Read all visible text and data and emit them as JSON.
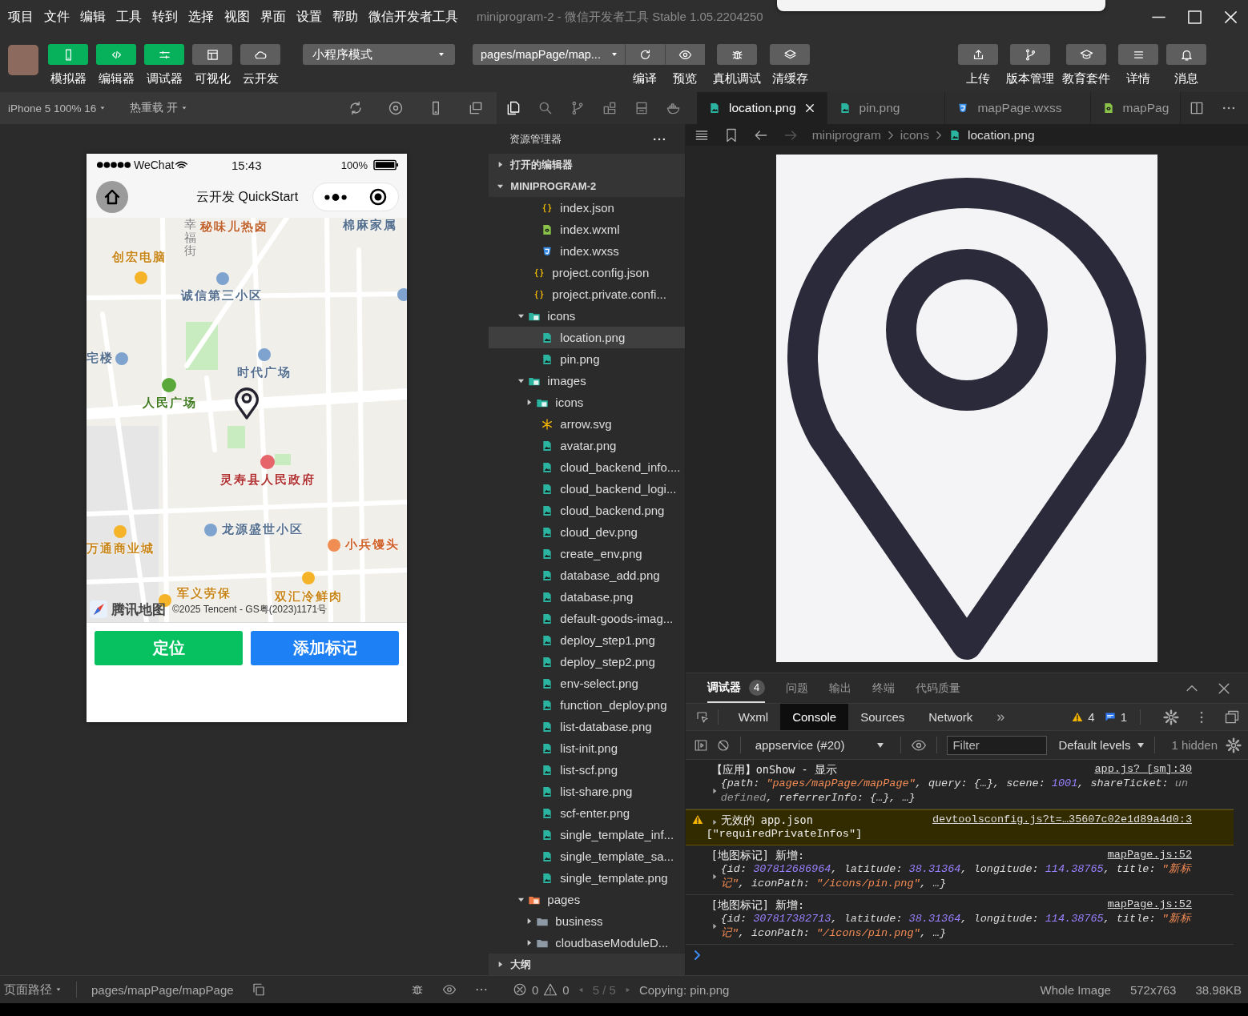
{
  "window": {
    "title": "miniprogram-2 - 微信开发者工具 Stable 1.05.2204250"
  },
  "menu": [
    "项目",
    "文件",
    "编辑",
    "工具",
    "转到",
    "选择",
    "视图",
    "界面",
    "设置",
    "帮助",
    "微信开发者工具"
  ],
  "toolbar": {
    "left": [
      {
        "label": "模拟器",
        "kind": "phone",
        "on": true
      },
      {
        "label": "编辑器",
        "kind": "code",
        "on": true
      },
      {
        "label": "调试器",
        "kind": "sliders",
        "on": true
      },
      {
        "label": "可视化",
        "kind": "layout",
        "on": false
      },
      {
        "label": "云开发",
        "kind": "cloud",
        "on": false
      }
    ],
    "mode": "小程序模式",
    "page": "pages/mapPage/map...",
    "page_actions": [
      {
        "label": "编译",
        "kind": "refresh"
      },
      {
        "label": "预览",
        "kind": "eye"
      }
    ],
    "middle": [
      {
        "label": "真机调试",
        "kind": "bug"
      },
      {
        "label": "清缓存",
        "kind": "layers"
      }
    ],
    "right": [
      {
        "label": "上传",
        "kind": "upload"
      },
      {
        "label": "版本管理",
        "kind": "branch"
      },
      {
        "label": "教育套件",
        "kind": "cap"
      },
      {
        "label": "详情",
        "kind": "menu"
      },
      {
        "label": "消息",
        "kind": "bell"
      }
    ]
  },
  "simulator": {
    "device": "iPhone 5 100% 16",
    "hot_reload": "热重载 开",
    "phone": {
      "carrier": "WeChat",
      "time": "15:43",
      "battery": "100%",
      "title": "云开发 QuickStart",
      "map": {
        "labels": [
          {
            "text": "幸福街",
            "color": "#7a7a7a"
          },
          {
            "text": "秘味儿热卤",
            "color": "#c0602a"
          },
          {
            "text": "创宏电脑",
            "color": "#c8861a"
          },
          {
            "text": "诚信第三小区",
            "color": "#56708f"
          },
          {
            "text": "宅楼",
            "color": "#56708f"
          },
          {
            "text": "时代广场",
            "color": "#56708f"
          },
          {
            "text": "人民广场",
            "color": "#3f7a1e"
          },
          {
            "text": "灵寿县人民政府",
            "color": "#b03030"
          },
          {
            "text": "龙源盛世小区",
            "color": "#56708f"
          },
          {
            "text": "万通商业城",
            "color": "#c8861a"
          },
          {
            "text": "小兵馒头",
            "color": "#d0602a"
          },
          {
            "text": "军义劳保",
            "color": "#c8861a"
          },
          {
            "text": "双汇冷鲜肉",
            "color": "#c8861a"
          },
          {
            "text": "棉麻家属",
            "color": "#56708f"
          }
        ],
        "logo": "腾讯地图",
        "copyright": "©2025 Tencent - GS粤(2023)1171号"
      },
      "buttons": [
        {
          "label": "定位",
          "color": "#07c160"
        },
        {
          "label": "添加标记",
          "color": "#1e80f5"
        }
      ]
    }
  },
  "activity": [
    {
      "kind": "files",
      "selected": true
    },
    {
      "kind": "search",
      "selected": false
    },
    {
      "kind": "git",
      "selected": false
    },
    {
      "kind": "extensions",
      "selected": false
    },
    {
      "kind": "box",
      "selected": false
    },
    {
      "kind": "docker",
      "selected": false
    }
  ],
  "explorer": {
    "title": "资源管理器",
    "sections": [
      {
        "label": "打开的编辑器",
        "expanded": false
      },
      {
        "label": "MINIPROGRAM-2",
        "expanded": true
      }
    ],
    "tree": [
      {
        "children": [
          {
            "label": "index.json",
            "kind": "json",
            "selected": false
          },
          {
            "label": "index.wxml",
            "kind": "wxml",
            "selected": false
          },
          {
            "label": "index.wxss",
            "kind": "wxss",
            "selected": false
          }
        ]
      },
      {
        "label": "project.config.json",
        "kind": "json",
        "selected": false
      },
      {
        "label": "project.private.confi...",
        "kind": "json",
        "selected": false
      },
      {
        "label": "icons",
        "kind": "image-folder",
        "expanded": true,
        "selected": false,
        "children": [
          {
            "label": "location.png",
            "kind": "image",
            "selected": true
          },
          {
            "label": "pin.png",
            "kind": "image",
            "selected": false
          }
        ]
      },
      {
        "label": "images",
        "kind": "image-folder",
        "expanded": true,
        "selected": false,
        "children": [
          {
            "label": "icons",
            "kind": "image-folder",
            "expanded": false,
            "selected": false
          },
          {
            "label": "arrow.svg",
            "kind": "svg",
            "selected": false
          },
          {
            "label": "avatar.png",
            "kind": "image",
            "selected": false
          },
          {
            "label": "cloud_backend_info....",
            "kind": "image",
            "selected": false
          },
          {
            "label": "cloud_backend_logi...",
            "kind": "image",
            "selected": false
          },
          {
            "label": "cloud_backend.png",
            "kind": "image",
            "selected": false
          },
          {
            "label": "cloud_dev.png",
            "kind": "image",
            "selected": false
          },
          {
            "label": "create_env.png",
            "kind": "image",
            "selected": false
          },
          {
            "label": "database_add.png",
            "kind": "image",
            "selected": false
          },
          {
            "label": "database.png",
            "kind": "image",
            "selected": false
          },
          {
            "label": "default-goods-imag...",
            "kind": "image",
            "selected": false
          },
          {
            "label": "deploy_step1.png",
            "kind": "image",
            "selected": false
          },
          {
            "label": "deploy_step2.png",
            "kind": "image",
            "selected": false
          },
          {
            "label": "env-select.png",
            "kind": "image",
            "selected": false
          },
          {
            "label": "function_deploy.png",
            "kind": "image",
            "selected": false
          },
          {
            "label": "list-database.png",
            "kind": "image",
            "selected": false
          },
          {
            "label": "list-init.png",
            "kind": "image",
            "selected": false
          },
          {
            "label": "list-scf.png",
            "kind": "image",
            "selected": false
          },
          {
            "label": "list-share.png",
            "kind": "image",
            "selected": false
          },
          {
            "label": "scf-enter.png",
            "kind": "image",
            "selected": false
          },
          {
            "label": "single_template_inf...",
            "kind": "image",
            "selected": false
          },
          {
            "label": "single_template_sa...",
            "kind": "image",
            "selected": false
          },
          {
            "label": "single_template.png",
            "kind": "image",
            "selected": false
          }
        ]
      },
      {
        "label": "pages",
        "kind": "page-folder",
        "expanded": true,
        "selected": false,
        "children": [
          {
            "label": "business",
            "kind": "folder",
            "expanded": false,
            "selected": false
          },
          {
            "label": "cloudbaseModuleD...",
            "kind": "folder",
            "expanded": false,
            "selected": false
          }
        ]
      }
    ],
    "outline": {
      "label": "大纲",
      "expanded": false
    }
  },
  "editor": {
    "tabs": [
      {
        "label": "location.png",
        "kind": "image",
        "selected": true
      },
      {
        "label": "pin.png",
        "kind": "image",
        "selected": false
      },
      {
        "label": "mapPage.wxss",
        "kind": "wxss",
        "selected": false
      },
      {
        "label": "mapPag",
        "kind": "wxml",
        "selected": false
      }
    ],
    "breadcrumb": [
      "miniprogram",
      "icons",
      "location.png"
    ]
  },
  "devtools": {
    "panels": [
      {
        "label": "调试器",
        "badge": "4",
        "selected": true
      },
      {
        "label": "问题",
        "selected": false
      },
      {
        "label": "输出",
        "selected": false
      },
      {
        "label": "终端",
        "selected": false
      },
      {
        "label": "代码质量",
        "selected": false
      }
    ],
    "tabs": [
      {
        "label": "Wxml",
        "selected": false
      },
      {
        "label": "Console",
        "selected": true
      },
      {
        "label": "Sources",
        "selected": false
      },
      {
        "label": "Network",
        "selected": false
      }
    ],
    "more": "»",
    "warnings": "4",
    "messages": "1",
    "context": "appservice (#20)",
    "filter_placeholder": "Filter",
    "levels": "Default levels",
    "hidden": "1 hidden",
    "entries": [
      {
        "kind": "log",
        "message": "【应用】onShow - 显示",
        "source": "app.js? [sm]:30",
        "preview": [
          {
            "kind": "plain",
            "text": "{path: "
          },
          {
            "kind": "string",
            "text": "\"pages/mapPage/mapPage\""
          },
          {
            "kind": "plain",
            "text": ", query: {…}, scene: "
          },
          {
            "kind": "number",
            "text": "1001"
          },
          {
            "kind": "plain",
            "text": ", shareTicket: "
          },
          {
            "kind": "undefined",
            "text": "undefined"
          },
          {
            "kind": "plain",
            "text": ", referrerInfo: {…}, …}"
          }
        ]
      },
      {
        "kind": "warning",
        "message": "无效的 app.json",
        "source": "devtoolsconfig.js?t=…35607c02e1d89a4d0:3",
        "detail": "[\"requiredPrivateInfos\"]"
      },
      {
        "kind": "log",
        "message": "[地图标记] 新增:",
        "source": "mapPage.js:52",
        "preview": [
          {
            "kind": "plain",
            "text": "{id: "
          },
          {
            "kind": "number",
            "text": "307812686964"
          },
          {
            "kind": "plain",
            "text": ", latitude: "
          },
          {
            "kind": "number",
            "text": "38.31364"
          },
          {
            "kind": "plain",
            "text": ", longitude: "
          },
          {
            "kind": "number",
            "text": "114.38765"
          },
          {
            "kind": "plain",
            "text": ", title: "
          },
          {
            "kind": "string",
            "text": "\"新标记\""
          },
          {
            "kind": "plain",
            "text": ", iconPath: "
          },
          {
            "kind": "string",
            "text": "\"/icons/pin.png\""
          },
          {
            "kind": "plain",
            "text": ", …}"
          }
        ]
      },
      {
        "kind": "log",
        "message": "[地图标记] 新增:",
        "source": "mapPage.js:52",
        "preview": [
          {
            "kind": "plain",
            "text": "{id: "
          },
          {
            "kind": "number",
            "text": "307817382713"
          },
          {
            "kind": "plain",
            "text": ", latitude: "
          },
          {
            "kind": "number",
            "text": "38.31364"
          },
          {
            "kind": "plain",
            "text": ", longitude: "
          },
          {
            "kind": "number",
            "text": "114.38765"
          },
          {
            "kind": "plain",
            "text": ", title: "
          },
          {
            "kind": "string",
            "text": "\"新标记\""
          },
          {
            "kind": "plain",
            "text": ", iconPath: "
          },
          {
            "kind": "string",
            "text": "\"/icons/pin.png\""
          },
          {
            "kind": "plain",
            "text": ", …}"
          }
        ]
      }
    ]
  },
  "status_bar": {
    "path_label": "页面路径",
    "path": "pages/mapPage/mapPage",
    "errors": "0",
    "warnings": "0",
    "pager": "5 / 5",
    "message": "Copying: pin.png",
    "view": "Whole Image",
    "dimensions": "572x763",
    "size": "38.98KB"
  }
}
